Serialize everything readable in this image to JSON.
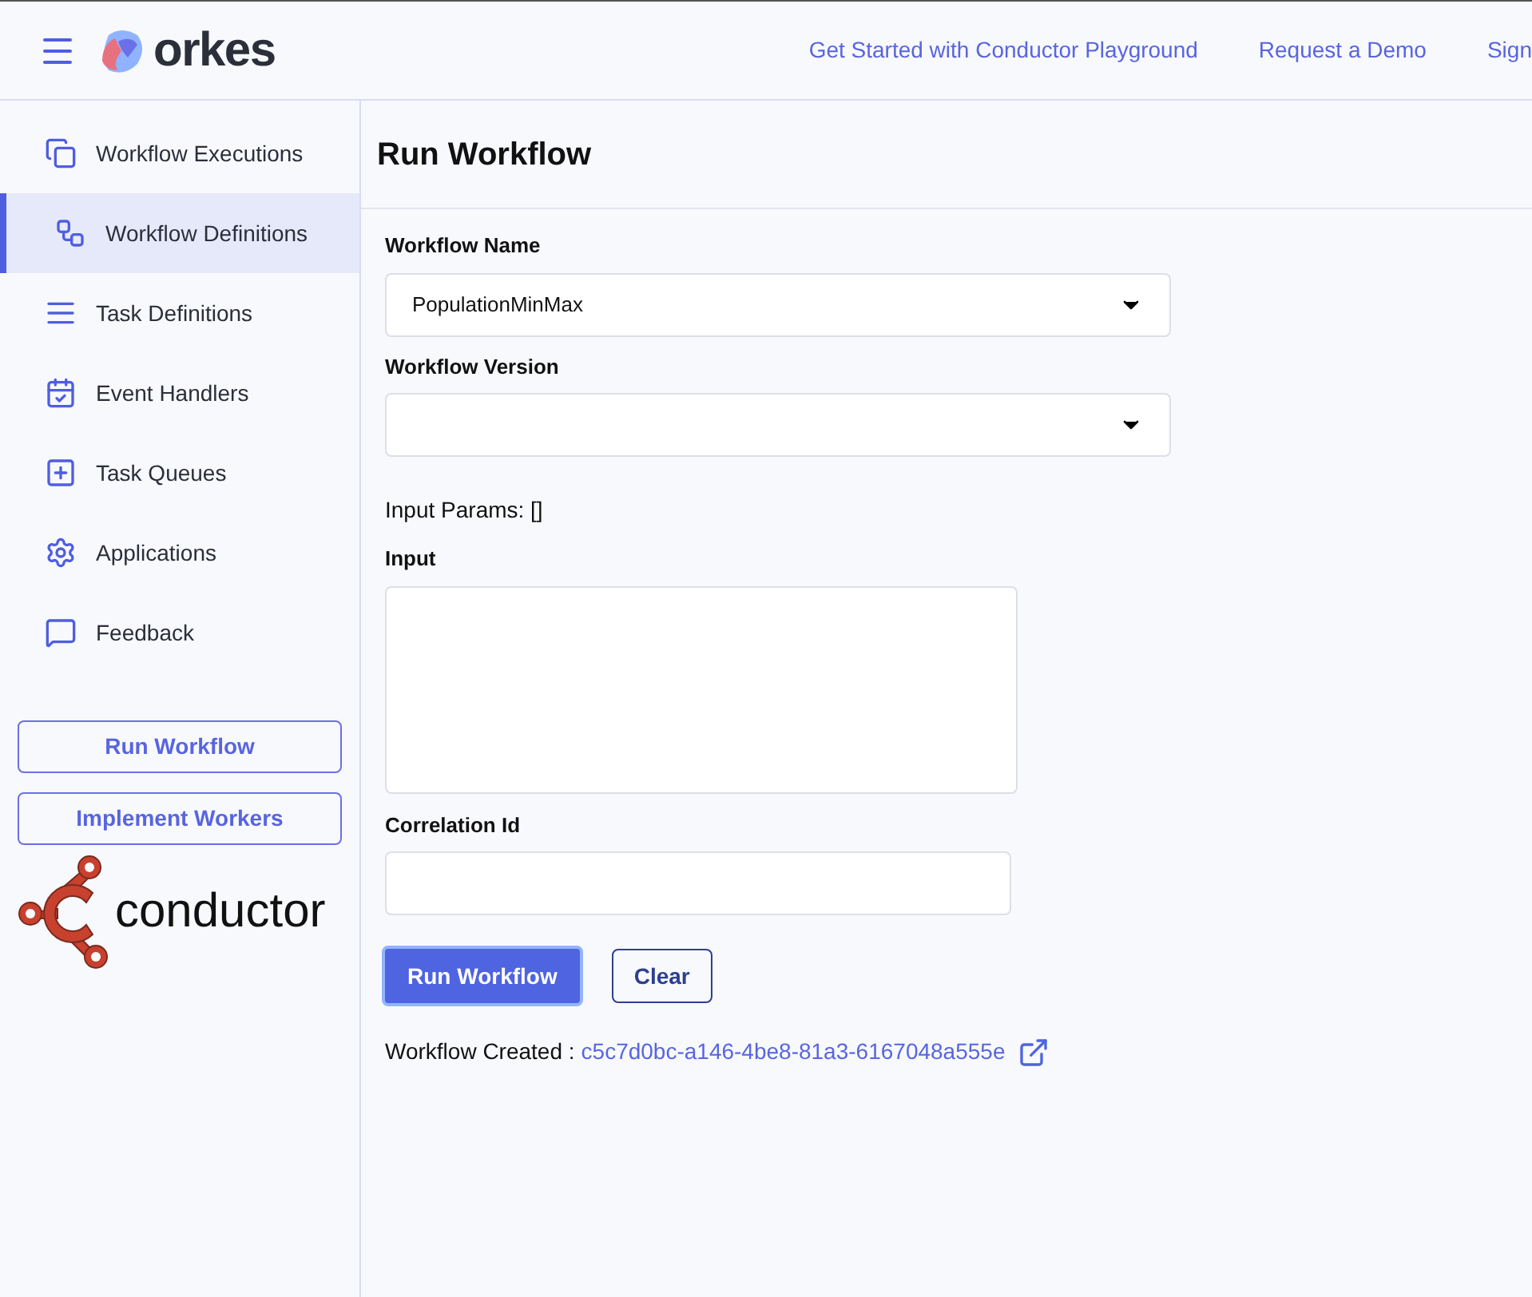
{
  "header": {
    "logo_text": "orkes",
    "links": [
      "Get Started with Conductor Playground",
      "Request a Demo",
      "Sign"
    ]
  },
  "sidebar": {
    "items": [
      {
        "label": "Workflow Executions",
        "selected": false
      },
      {
        "label": "Workflow Definitions",
        "selected": true
      },
      {
        "label": "Task Definitions",
        "selected": false
      },
      {
        "label": "Event Handlers",
        "selected": false
      },
      {
        "label": "Task Queues",
        "selected": false
      },
      {
        "label": "Applications",
        "selected": false
      },
      {
        "label": "Feedback",
        "selected": false
      }
    ],
    "buttons": [
      "Run Workflow",
      "Implement Workers"
    ],
    "brand_text": "conductor"
  },
  "page": {
    "title": "Run Workflow",
    "workflow_name": {
      "label": "Workflow Name",
      "value": "PopulationMinMax"
    },
    "workflow_version": {
      "label": "Workflow Version"
    },
    "input_params": "Input Params: []",
    "input": {
      "label": "Input"
    },
    "correlation_id": {
      "label": "Correlation Id"
    },
    "run_button": "Run Workflow",
    "clear_button": "Clear",
    "result": {
      "label": "Workflow Created :",
      "link": "c5c7d0bc-a146-4be8-81a3-6167048a555e"
    }
  }
}
